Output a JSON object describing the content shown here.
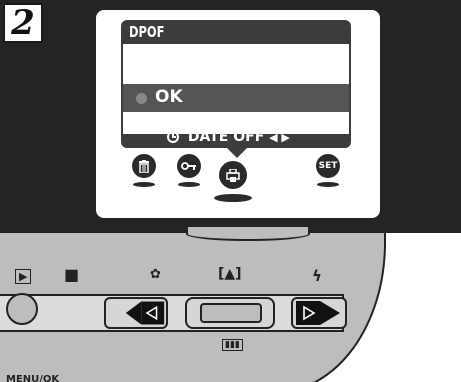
{
  "step": {
    "number": "2"
  },
  "menu": {
    "title": "DPOF",
    "selected_option": "OK",
    "footer_label": "DATE",
    "footer_value": "OFF",
    "footer_arrows": "◀ ▶"
  },
  "menu_icons": [
    {
      "name": "trash-icon",
      "glyph": "🗑"
    },
    {
      "name": "protect-key-icon",
      "glyph": "O┐"
    },
    {
      "name": "print-order-icon",
      "glyph": "⎙"
    },
    {
      "name": "set-icon",
      "glyph": "SET"
    }
  ],
  "camera": {
    "playback_label": "▶",
    "camera_label": "■",
    "macro_label": "✿",
    "display_label": "[▲]",
    "flash_label": "ϟ",
    "multi_label": "▮▮▮",
    "left_button_glyph": "◁",
    "right_button_glyph": "▷",
    "menu_ok_label": "MENU/OK"
  },
  "colors": {
    "panel": "#242424",
    "menu": "#3c3c3c",
    "camera_body": "#bdbdbd"
  }
}
